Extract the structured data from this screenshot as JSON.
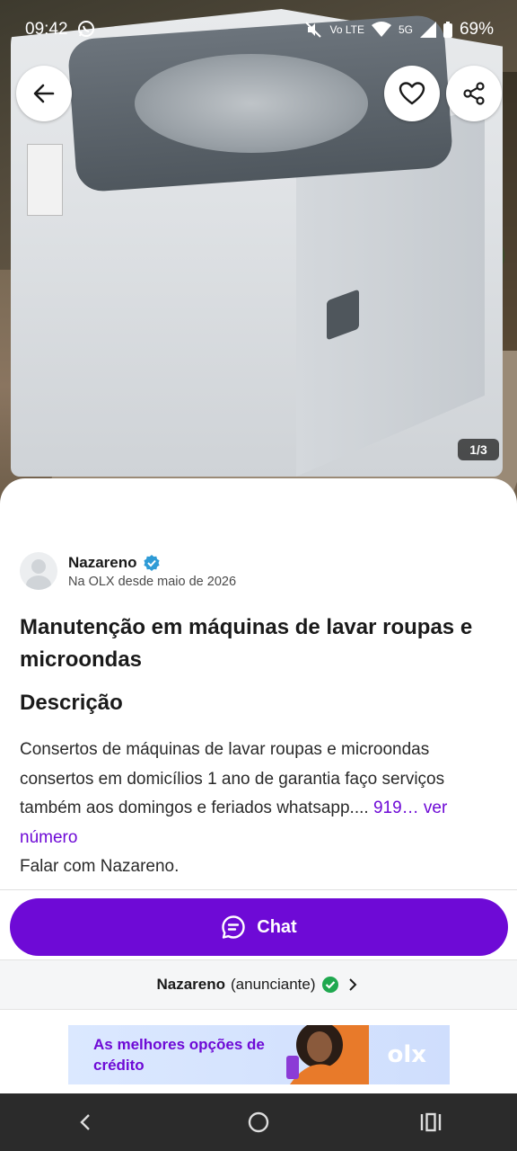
{
  "status_bar": {
    "time": "09:42",
    "network": "5G",
    "volte": "Vo LTE",
    "battery": "69%"
  },
  "photo": {
    "counter": "1/3"
  },
  "seller": {
    "name": "Nazareno",
    "since": "Na OLX desde maio de 2026"
  },
  "ad": {
    "title": "Manutenção em máquinas de lavar roupas e microondas",
    "description_heading": "Descrição",
    "description": "Consertos de máquinas de lavar roupas e microondas consertos em domicílios 1 ano de garantia faço serviços também aos domingos e feriados whatsapp.... ",
    "phone_link": "919… ver número",
    "contact_line": "Falar com Nazareno."
  },
  "chat": {
    "label": "Chat"
  },
  "advertiser": {
    "name": "Nazareno",
    "role": "(anunciante)"
  },
  "banner": {
    "text": "As melhores opções de crédito",
    "logo": "olx"
  },
  "colors": {
    "brand_purple": "#6e0ad6",
    "verified_blue": "#2e9bd6",
    "verified_green": "#1fa84f"
  }
}
